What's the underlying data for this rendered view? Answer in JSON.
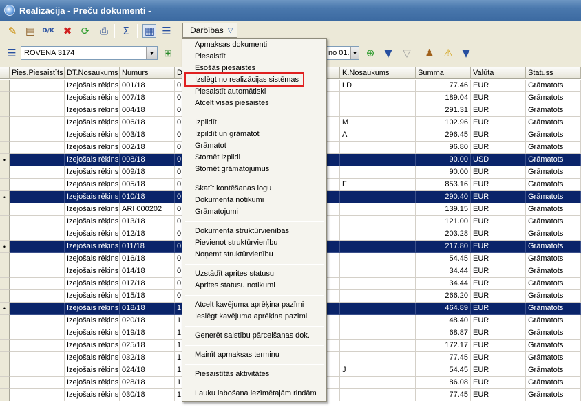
{
  "window": {
    "title": "Realizācija - Preču dokumenti -"
  },
  "toolbar": {
    "actions_label": "Darbības",
    "icons": [
      "edit-icon",
      "print-preview-icon",
      "dk-icon",
      "delete-icon",
      "refresh-icon",
      "print-icon",
      "sum-icon",
      "grid-view-icon",
      "tree-icon"
    ]
  },
  "filter": {
    "client": "ROVENA 3174",
    "period": "no 01.0"
  },
  "grid": {
    "columns": [
      "Pies.Piesaistīts",
      "DT.Nosaukums",
      "Numurs",
      "D",
      "K.Nosaukums",
      "Summa",
      "Valūta",
      "Statuss"
    ],
    "rows": [
      {
        "doc": "Izejošais rēķins",
        "num": "001/18",
        "d": "0",
        "sum": "77.46",
        "cur": "EUR",
        "status": "Grāmatots",
        "sel": false,
        "k": "LD"
      },
      {
        "doc": "Izejošais rēķins",
        "num": "007/18",
        "d": "0",
        "sum": "189.04",
        "cur": "EUR",
        "status": "Grāmatots",
        "sel": false,
        "k": ""
      },
      {
        "doc": "Izejošais rēķins",
        "num": "004/18",
        "d": "0",
        "sum": "291.31",
        "cur": "EUR",
        "status": "Grāmatots",
        "sel": false,
        "k": ""
      },
      {
        "doc": "Izejošais rēķins",
        "num": "006/18",
        "d": "0",
        "sum": "102.96",
        "cur": "EUR",
        "status": "Grāmatots",
        "sel": false,
        "k": "M"
      },
      {
        "doc": "Izejošais rēķins",
        "num": "003/18",
        "d": "0",
        "sum": "296.45",
        "cur": "EUR",
        "status": "Grāmatots",
        "sel": false,
        "k": "A"
      },
      {
        "doc": "Izejošais rēķins",
        "num": "002/18",
        "d": "0",
        "sum": "96.80",
        "cur": "EUR",
        "status": "Grāmatots",
        "sel": false,
        "k": ""
      },
      {
        "doc": "Izejošais rēķins",
        "num": "008/18",
        "d": "0",
        "sum": "90.00",
        "cur": "USD",
        "status": "Grāmatots",
        "sel": true,
        "k": ""
      },
      {
        "doc": "Izejošais rēķins",
        "num": "009/18",
        "d": "0",
        "sum": "90.00",
        "cur": "EUR",
        "status": "Grāmatots",
        "sel": false,
        "k": ""
      },
      {
        "doc": "Izejošais rēķins",
        "num": "005/18",
        "d": "0",
        "sum": "853.16",
        "cur": "EUR",
        "status": "Grāmatots",
        "sel": false,
        "k": "F"
      },
      {
        "doc": "Izejošais rēķins",
        "num": "010/18",
        "d": "0",
        "sum": "290.40",
        "cur": "EUR",
        "status": "Grāmatots",
        "sel": true,
        "k": ""
      },
      {
        "doc": "Izejošais rēķins",
        "num": "ARI 000202",
        "d": "0",
        "sum": "139.15",
        "cur": "EUR",
        "status": "Grāmatots",
        "sel": false,
        "k": ""
      },
      {
        "doc": "Izejošais rēķins",
        "num": "013/18",
        "d": "0",
        "sum": "121.00",
        "cur": "EUR",
        "status": "Grāmatots",
        "sel": false,
        "k": ""
      },
      {
        "doc": "Izejošais rēķins",
        "num": "012/18",
        "d": "0",
        "sum": "203.28",
        "cur": "EUR",
        "status": "Grāmatots",
        "sel": false,
        "k": ""
      },
      {
        "doc": "Izejošais rēķins",
        "num": "011/18",
        "d": "0",
        "sum": "217.80",
        "cur": "EUR",
        "status": "Grāmatots",
        "sel": true,
        "k": ""
      },
      {
        "doc": "Izejošais rēķins",
        "num": "016/18",
        "d": "0",
        "sum": "54.45",
        "cur": "EUR",
        "status": "Grāmatots",
        "sel": false,
        "k": ""
      },
      {
        "doc": "Izejošais rēķins",
        "num": "014/18",
        "d": "0",
        "sum": "34.44",
        "cur": "EUR",
        "status": "Grāmatots",
        "sel": false,
        "k": ""
      },
      {
        "doc": "Izejošais rēķins",
        "num": "017/18",
        "d": "0",
        "sum": "34.44",
        "cur": "EUR",
        "status": "Grāmatots",
        "sel": false,
        "k": ""
      },
      {
        "doc": "Izejošais rēķins",
        "num": "015/18",
        "d": "0",
        "sum": "266.20",
        "cur": "EUR",
        "status": "Grāmatots",
        "sel": false,
        "k": ""
      },
      {
        "doc": "Izejošais rēķins",
        "num": "018/18",
        "d": "1",
        "sum": "464.89",
        "cur": "EUR",
        "status": "Grāmatots",
        "sel": true,
        "k": ""
      },
      {
        "doc": "Izejošais rēķins",
        "num": "020/18",
        "d": "1",
        "sum": "48.40",
        "cur": "EUR",
        "status": "Grāmatots",
        "sel": false,
        "k": ""
      },
      {
        "doc": "Izejošais rēķins",
        "num": "019/18",
        "d": "1",
        "sum": "68.87",
        "cur": "EUR",
        "status": "Grāmatots",
        "sel": false,
        "k": ""
      },
      {
        "doc": "Izejošais rēķins",
        "num": "025/18",
        "d": "1",
        "sum": "172.17",
        "cur": "EUR",
        "status": "Grāmatots",
        "sel": false,
        "k": ""
      },
      {
        "doc": "Izejošais rēķins",
        "num": "032/18",
        "d": "1",
        "sum": "77.45",
        "cur": "EUR",
        "status": "Grāmatots",
        "sel": false,
        "k": ""
      },
      {
        "doc": "Izejošais rēķins",
        "num": "024/18",
        "d": "1",
        "sum": "54.45",
        "cur": "EUR",
        "status": "Grāmatots",
        "sel": false,
        "k": "J"
      },
      {
        "doc": "Izejošais rēķins",
        "num": "028/18",
        "d": "1",
        "sum": "86.08",
        "cur": "EUR",
        "status": "Grāmatots",
        "sel": false,
        "k": ""
      },
      {
        "doc": "Izejošais rēķins",
        "num": "030/18",
        "d": "1",
        "sum": "77.45",
        "cur": "EUR",
        "status": "Grāmatots",
        "sel": false,
        "k": ""
      }
    ]
  },
  "menu": {
    "items": [
      "Apmaksas dokumenti",
      "Piesaistīt",
      "Esošās piesaistes",
      "Izslēgt no realizācijas sistēmas",
      "Piesaistīt automātiski",
      "Atcelt visas piesaistes",
      "Izpildīt",
      "Izpildīt un grāmatot",
      "Grāmatot",
      "Stornēt izpildi",
      "Stornēt grāmatojumus",
      "Skatīt kontēšanas logu",
      "Dokumenta notikumi",
      "Grāmatojumi",
      "Dokumenta struktūrvienības",
      "Pievienot struktūrvienību",
      "Noņemt struktūrvienību",
      "Uzstādīt aprites statusu",
      "Aprites statusu notikumi",
      "Atcelt kavējuma aprēķina pazīmi",
      "Ieslēgt kavējuma aprēķina pazīmi",
      "Ģenerēt saistību pārcelšanas dok.",
      "Mainīt apmaksas termiņu",
      "Piesaistītās aktivitātes",
      "Lauku labošana iezīmētajām rindām"
    ],
    "highlighted": "Izslēgt no realizācijas sistēmas"
  }
}
